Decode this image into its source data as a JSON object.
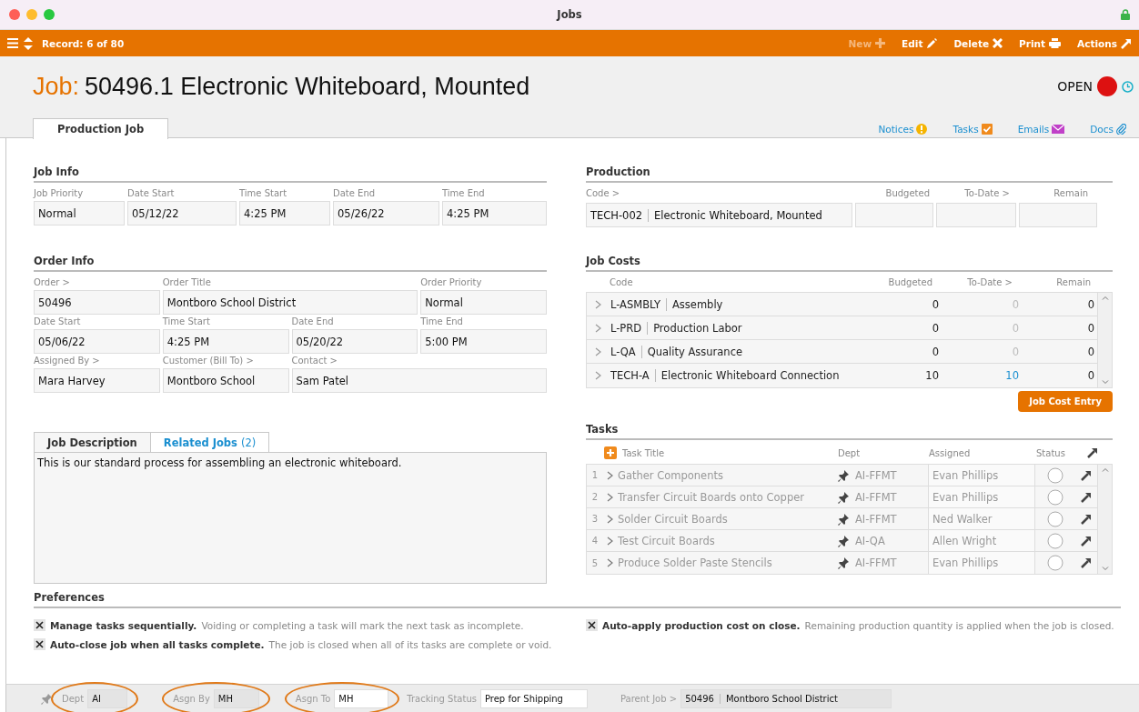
{
  "window": {
    "title": "Jobs"
  },
  "toolbar": {
    "record": "Record: 6 of 80",
    "actions": [
      {
        "label": "New",
        "kind": "new",
        "disabled": true
      },
      {
        "label": "Edit",
        "kind": "edit",
        "disabled": false
      },
      {
        "label": "Delete",
        "kind": "delete",
        "disabled": false
      },
      {
        "label": "Print",
        "kind": "print",
        "disabled": false
      },
      {
        "label": "Actions",
        "kind": "actions",
        "disabled": false
      }
    ]
  },
  "header": {
    "prefix": "Job:",
    "title": "50496.1 Electronic Whiteboard, Mounted",
    "status": "OPEN"
  },
  "tabs": [
    {
      "label": "Production Job",
      "selected": true
    }
  ],
  "links": [
    {
      "label": "Notices",
      "kind": "notices"
    },
    {
      "label": "Tasks",
      "kind": "tasks"
    },
    {
      "label": "Emails",
      "kind": "emails"
    },
    {
      "label": "Docs",
      "kind": "docs"
    }
  ],
  "job_info": {
    "heading": "Job Info",
    "fields": [
      {
        "label": "Job Priority",
        "value": "Normal"
      },
      {
        "label": "Date Start",
        "value": "05/12/22"
      },
      {
        "label": "Time Start",
        "value": "4:25 PM"
      },
      {
        "label": "Date End",
        "value": "05/26/22"
      },
      {
        "label": "Time End",
        "value": "4:25 PM"
      }
    ]
  },
  "order_info": {
    "heading": "Order Info",
    "fields": [
      {
        "label": "Order >",
        "value": "50496"
      },
      {
        "label": "Order Title",
        "value": "Montboro School District"
      },
      {
        "label": "Order Priority",
        "value": "Normal"
      },
      {
        "label": "Date Start",
        "value": "05/06/22"
      },
      {
        "label": "Time Start",
        "value": "4:25 PM"
      },
      {
        "label": "Date End",
        "value": "05/20/22"
      },
      {
        "label": "Time End",
        "value": "5:00 PM"
      },
      {
        "label": "Assigned By >",
        "value": "Mara Harvey"
      },
      {
        "label": "Customer (Bill To) >",
        "value": "Montboro School"
      },
      {
        "label": "Contact >",
        "value": "Sam Patel"
      }
    ]
  },
  "production": {
    "heading": "Production",
    "columns": [
      "Code >",
      "Budgeted",
      "To-Date >",
      "Remain"
    ],
    "code": "TECH-002",
    "name": "Electronic Whiteboard, Mounted"
  },
  "job_costs": {
    "heading": "Job Costs",
    "columns": [
      "Code",
      "Budgeted",
      "To-Date >",
      "Remain"
    ],
    "rows": [
      {
        "code": "L-ASMBLY",
        "name": "Assembly",
        "budgeted": "0",
        "to_date": "0",
        "to_date_linked": false,
        "remain": "0"
      },
      {
        "code": "L-PRD",
        "name": "Production Labor",
        "budgeted": "0",
        "to_date": "0",
        "to_date_linked": false,
        "remain": "0"
      },
      {
        "code": "L-QA",
        "name": "Quality Assurance",
        "budgeted": "0",
        "to_date": "0",
        "to_date_linked": false,
        "remain": "0"
      },
      {
        "code": "TECH-A",
        "name": "Electronic Whiteboard Connection",
        "budgeted": "10",
        "to_date": "10",
        "to_date_linked": true,
        "remain": "0"
      }
    ],
    "button": "Job Cost Entry"
  },
  "description": {
    "tabs": [
      {
        "label": "Job Description",
        "selected": true
      },
      {
        "label": "Related Jobs",
        "count": "(2)",
        "selected": false
      }
    ],
    "text": "This is our standard process for assembling an electronic whiteboard."
  },
  "tasks": {
    "heading": "Tasks",
    "columns": [
      "Task Title",
      "Dept",
      "Assigned",
      "Status"
    ],
    "rows": [
      {
        "number": "1",
        "title": "Gather Components",
        "dept": "AI-FFMT",
        "assigned": "Evan Phillips",
        "done": false
      },
      {
        "number": "2",
        "title": "Transfer Circuit Boards onto Copper",
        "dept": "AI-FFMT",
        "assigned": "Evan Phillips",
        "done": false
      },
      {
        "number": "3",
        "title": "Solder Circuit Boards",
        "dept": "AI-FFMT",
        "assigned": "Ned Walker",
        "done": false
      },
      {
        "number": "4",
        "title": "Test Circuit Boards",
        "dept": "AI-QA",
        "assigned": "Allen Wright",
        "done": false
      },
      {
        "number": "5",
        "title": "Produce Solder Paste Stencils",
        "dept": "AI-FFMT",
        "assigned": "Evan Phillips",
        "done": false
      }
    ]
  },
  "preferences": {
    "heading": "Preferences",
    "options": [
      {
        "title": "Manage tasks sequentially.",
        "note": "Voiding or completing a task will mark the next task as incomplete.",
        "checked": true
      },
      {
        "title": "Auto-close job when all tasks complete.",
        "note": "The job is closed when all of its tasks are complete or void.",
        "checked": true
      },
      {
        "title": "Auto-apply production cost on close.",
        "note": "Remaining production quantity is applied when the job is closed.",
        "checked": true
      }
    ]
  },
  "status_bar": {
    "fields": [
      {
        "label": "Dept",
        "value": "AI",
        "highlighted": true
      },
      {
        "label": "Asgn By",
        "value": "MH",
        "highlighted": true
      },
      {
        "label": "Asgn To",
        "value": "MH",
        "highlighted": true
      },
      {
        "label": "Tracking Status",
        "value": "Prep for Shipping",
        "highlighted": false
      },
      {
        "label": "Parent Job >",
        "value": "50496",
        "value_name": "Montboro School District",
        "highlighted": false
      }
    ]
  }
}
